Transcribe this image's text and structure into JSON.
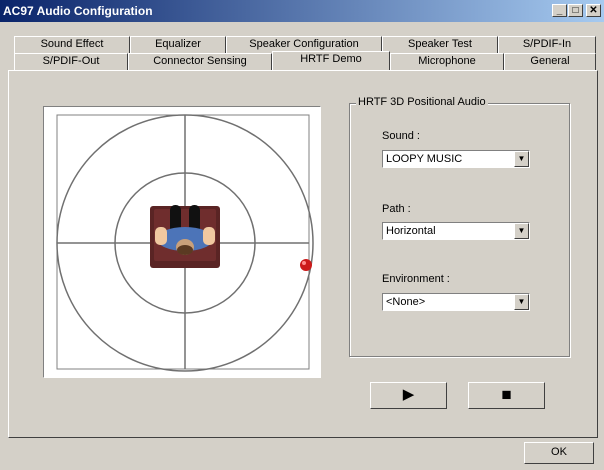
{
  "window": {
    "title": "AC97 Audio Configuration"
  },
  "titlebar": {
    "minimize": "_",
    "maximize": "□",
    "close": "✕"
  },
  "tabs_row1": [
    "Sound Effect",
    "Equalizer",
    "Speaker Configuration",
    "Speaker Test",
    "S/PDIF-In"
  ],
  "tabs_row2": [
    "S/PDIF-Out",
    "Connector Sensing",
    "HRTF Demo",
    "Microphone",
    "General"
  ],
  "group": {
    "title": "HRTF 3D Positional Audio"
  },
  "fields": {
    "sound": {
      "label": "Sound :",
      "value": "LOOPY MUSIC"
    },
    "path": {
      "label": "Path :",
      "value": "Horizontal"
    },
    "environment": {
      "label": "Environment :",
      "value": "<None>"
    }
  },
  "buttons": {
    "play": "▶",
    "stop": "■",
    "ok": "OK"
  },
  "icons": {
    "play": "play-icon",
    "stop": "stop-icon"
  }
}
